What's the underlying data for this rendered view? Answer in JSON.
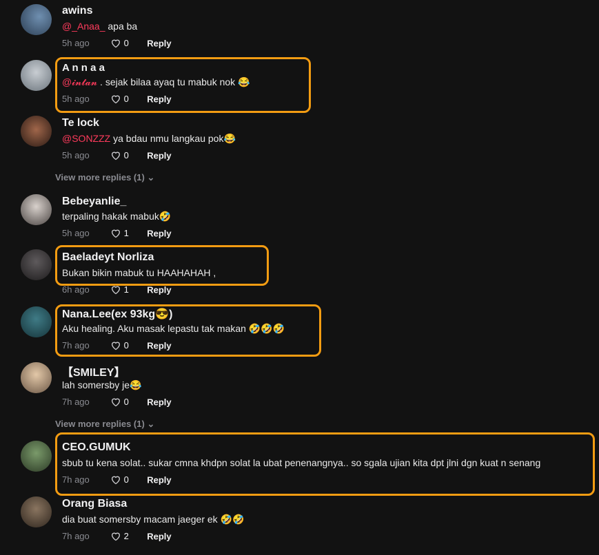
{
  "colors": {
    "accent": "#f39c12",
    "mention": "#ff3b5c",
    "bg": "#121212"
  },
  "comments": [
    {
      "username": "awins",
      "mention": "@_Anaa_",
      "text": " apa ba",
      "time": "5h ago",
      "likes": "0",
      "reply": "Reply"
    },
    {
      "username": "A n n a a",
      "mention": "@𝓲𝓷𝓽𝓪𝓷",
      "text": " . sejak bilaa ayaq tu mabuk nok 😂",
      "time": "5h ago",
      "likes": "0",
      "reply": "Reply"
    },
    {
      "username": "Te lock",
      "mention": "@SONZZZ",
      "text": " ya bdau nmu langkau pok😂",
      "time": "5h ago",
      "likes": "0",
      "reply": "Reply"
    },
    {
      "username": "Bebeyanlie_",
      "mention": "",
      "text": "terpaling hakak mabuk🤣",
      "time": "5h ago",
      "likes": "1",
      "reply": "Reply"
    },
    {
      "username": "Baeladeyt Norliza",
      "mention": "",
      "text": "Bukan bikin mabuk tu HAAHAHAH ,",
      "time": "6h ago",
      "likes": "1",
      "reply": "Reply"
    },
    {
      "username": "Nana.Lee(ex 93kg😎)",
      "mention": "",
      "text": "Aku healing. Aku masak lepastu tak makan 🤣🤣🤣",
      "time": "7h ago",
      "likes": "0",
      "reply": "Reply"
    },
    {
      "username": "【SMILEY】",
      "mention": "",
      "text": "lah somersby je😂",
      "time": "7h ago",
      "likes": "0",
      "reply": "Reply"
    },
    {
      "username": "CEO.GUMUK",
      "mention": "",
      "text": "sbub tu kena solat.. sukar cmna khdpn solat la ubat penenangnya.. so sgala ujian kita dpt jlni dgn kuat n senang",
      "time": "7h ago",
      "likes": "0",
      "reply": "Reply"
    },
    {
      "username": "Orang Biasa",
      "mention": "",
      "text": "dia buat somersby macam jaeger ek 🤣🤣",
      "time": "7h ago",
      "likes": "2",
      "reply": "Reply"
    }
  ],
  "view_more": [
    "View more replies (1)",
    "View more replies (1)"
  ]
}
